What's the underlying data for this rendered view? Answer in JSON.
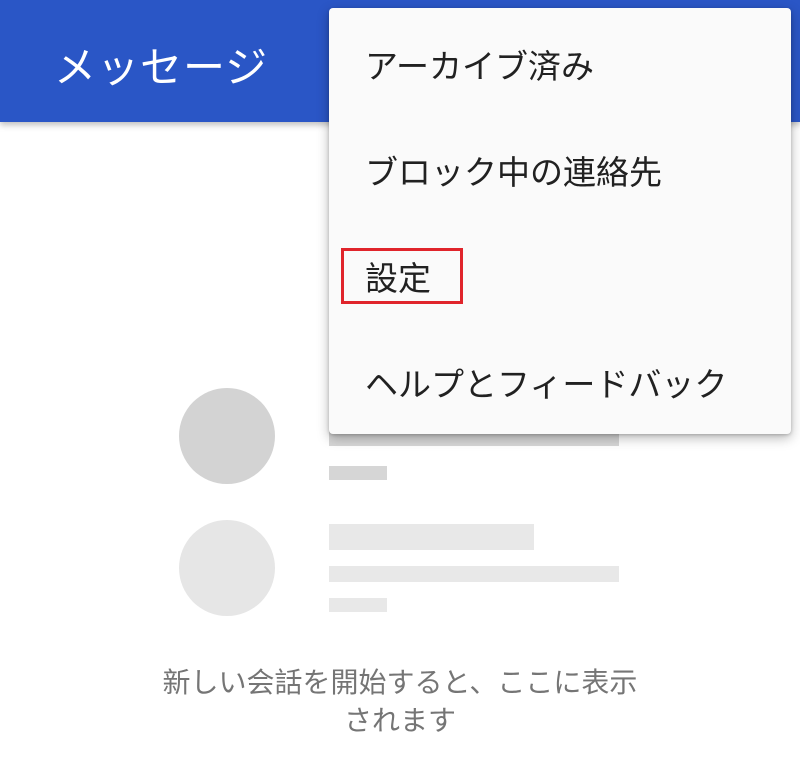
{
  "app_bar": {
    "title": "メッセージ",
    "color": "#2a56c6"
  },
  "overflow_menu": {
    "items": [
      {
        "label": "アーカイブ済み"
      },
      {
        "label": "ブロック中の連絡先"
      },
      {
        "label": "設定",
        "highlighted": true
      },
      {
        "label": "ヘルプとフィードバック"
      }
    ],
    "highlight_color": "#e0242b"
  },
  "empty_state": {
    "message_line1": "新しい会話を開始すると、ここに表示",
    "message_line2": "されます"
  }
}
